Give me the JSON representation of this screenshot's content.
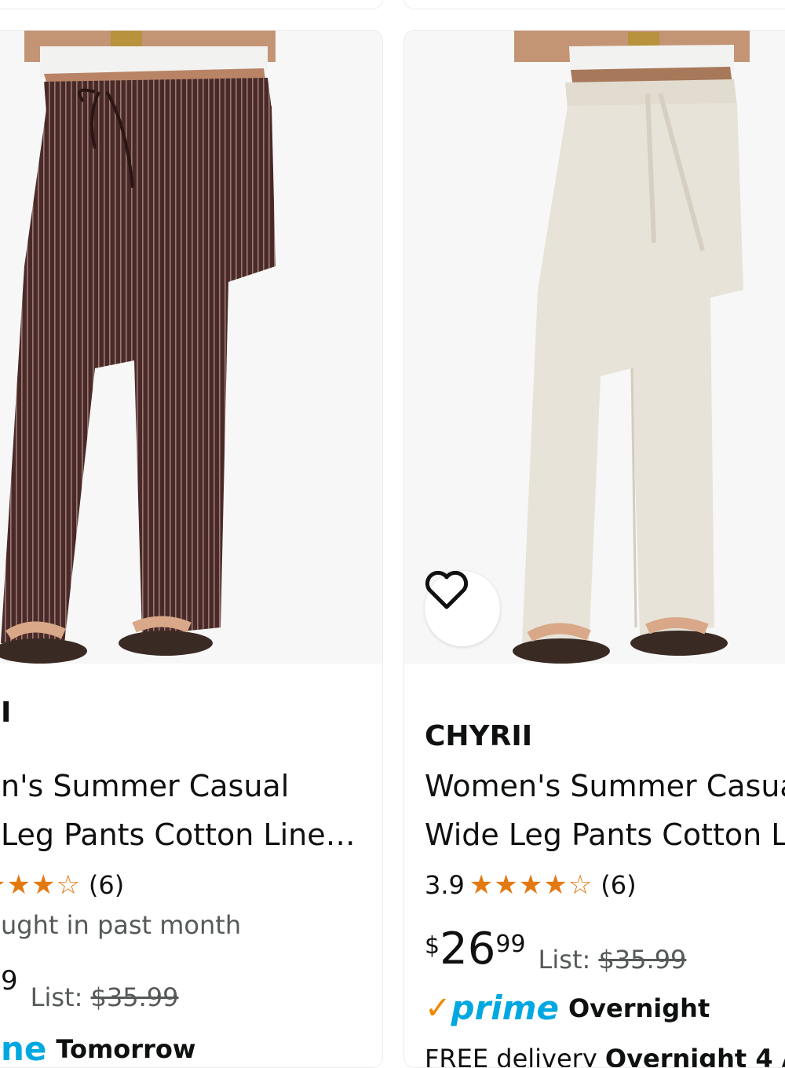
{
  "products": [
    {
      "brand": "I",
      "title_line1": "n's Summer Casual",
      "title_line2": "Leg Pants Cotton Line…",
      "stars": "★★★☆",
      "review_count": "(6)",
      "bought_text": "ught in past month",
      "price_partial": "9",
      "list_label": "List: ",
      "list_price": "$35.99",
      "prime_partial": "ne",
      "shipping": "Tomorrow"
    },
    {
      "brand": "CHYRII",
      "title_line1": "Women's Summer Casua",
      "title_line2": "Wide Leg Pants Cotton L",
      "rating": "3.9",
      "stars": "★★★★☆",
      "review_count": "(6)",
      "price_currency": "$",
      "price_whole": "26",
      "price_fraction": "99",
      "list_label": "List: ",
      "list_price": "$35.99",
      "prime_check": "✓",
      "prime_word": "prime",
      "shipping": "Overnight",
      "free_delivery": "FREE delivery ",
      "free_delivery_bold": "Overnight 4 A"
    }
  ],
  "colors": {
    "star": "#e47911",
    "prime_blue": "#00a8e1",
    "prime_orange": "#f08804",
    "text": "#0f1111",
    "muted": "#565959"
  },
  "icons": {
    "favorite": "heart-outline-icon",
    "rating": "star-icon",
    "prime": "prime-logo-icon"
  }
}
